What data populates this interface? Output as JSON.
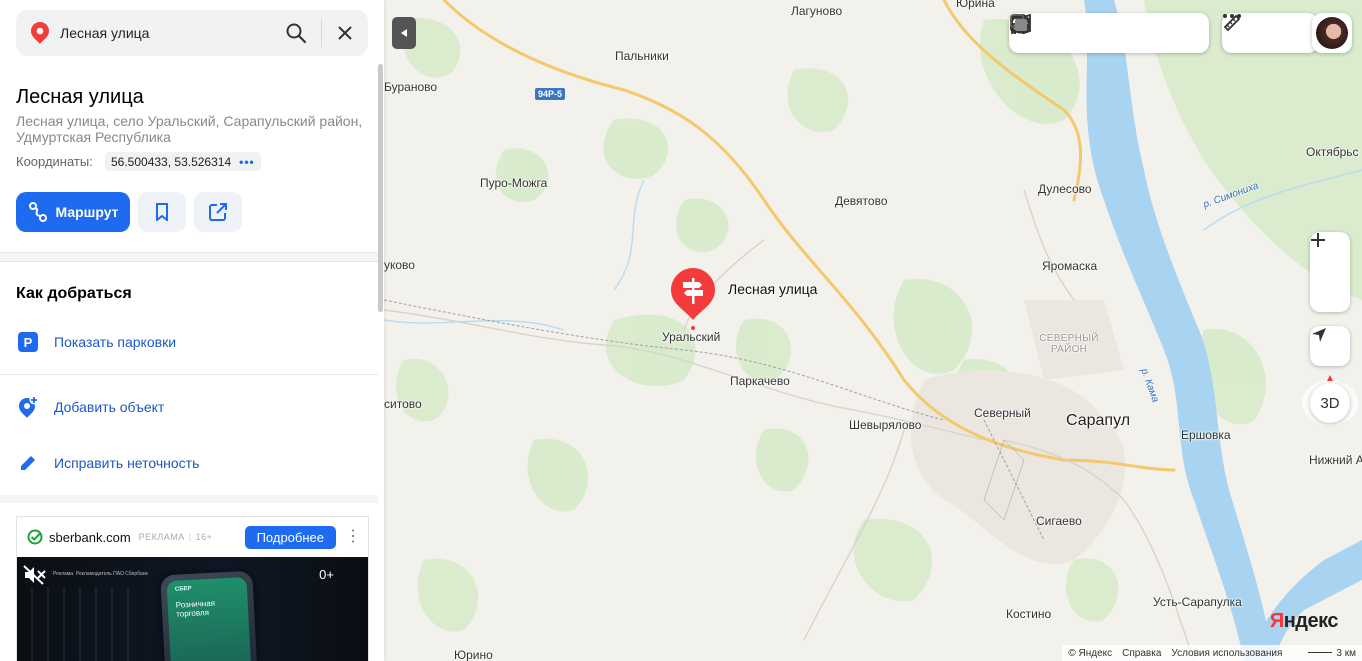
{
  "search": {
    "value": "Лесная улица"
  },
  "place": {
    "title": "Лесная улица",
    "address": "Лесная улица, село Уральский, Сарапульский район, Удмуртская Республика",
    "coords_label": "Координаты:",
    "coords_value": "56.500433, 53.526314"
  },
  "actions": {
    "route_label": "Маршрут"
  },
  "directions": {
    "title": "Как добраться",
    "parking_label": "Показать парковки",
    "add_object_label": "Добавить объект",
    "fix_label": "Исправить неточность"
  },
  "ad": {
    "domain": "sberbank.com",
    "tag": "РЕКЛАМА",
    "age": "16+",
    "button_label": "Подробнее",
    "age_badge": "0+",
    "fine_print": "Реклама. Рекламодатель ПАО Сбербанк",
    "phone_brand": "СБЕР",
    "phone_text": "Розничная торговля"
  },
  "map": {
    "pin_label": "Лесная улица",
    "road_badge": "94Р-5",
    "places": {
      "lagunovo": "Лагуново",
      "yurino_top": "Юрина",
      "palniki": "Пальники",
      "buranovo": "Бураново",
      "puro_mozhga": "Пуро-Можга",
      "devyatovo": "Девятово",
      "dulesovo": "Дулесово",
      "oktyabrsky": "Октябрьс",
      "zhukovo": "уково",
      "yaromaska": "Яромаска",
      "uralsky": "Уральский",
      "severny_district": "СЕВЕРНЫЙ РАЙОН",
      "parkachevo": "Паркачево",
      "sitovo": "ситово",
      "severny": "Северный",
      "shevyryalovo": "Шевырялово",
      "sarapul": "Сарапул",
      "ershovka": "Ершовка",
      "nizhny": "Нижний А",
      "sigaevo": "Сигаево",
      "kostino": "Костино",
      "ust_sarapulka": "Усть-Сарапулка",
      "yurino": "Юрино",
      "river_simoniha": "р. Симониха",
      "river_kama": "р. Кама"
    },
    "button_3d": "3D",
    "logo": "Яндекс",
    "footer": {
      "copyright": "© Яндекс",
      "help": "Справка",
      "terms": "Условия использования",
      "scale": "3 км"
    }
  },
  "colors": {
    "accent": "#1e6bf0",
    "pin": "#f43b3b",
    "water": "#a8d4f2",
    "forest": "#d6ecc9"
  }
}
